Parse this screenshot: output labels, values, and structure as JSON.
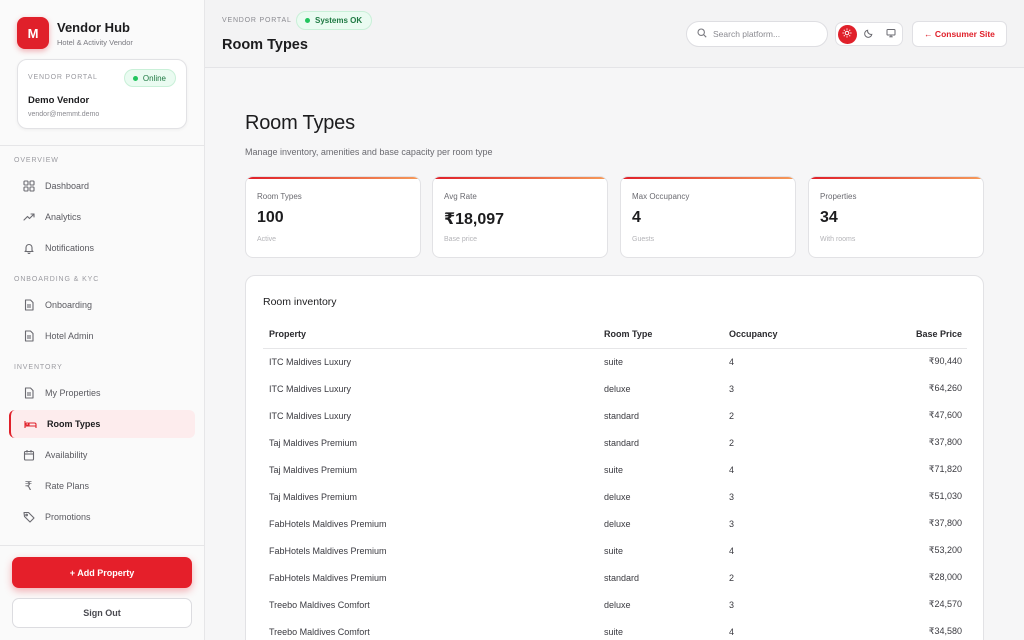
{
  "brand": {
    "logo_letter": "M",
    "name": "Vendor Hub",
    "subtitle": "Hotel & Activity Vendor"
  },
  "vendor_card": {
    "label": "VENDOR PORTAL",
    "status": "Online",
    "name": "Demo Vendor",
    "email": "vendor@memmt.demo"
  },
  "sidebar": {
    "sections": [
      {
        "label": "OVERVIEW",
        "items": [
          {
            "label": "Dashboard",
            "icon": "grid-icon"
          },
          {
            "label": "Analytics",
            "icon": "trend-icon"
          },
          {
            "label": "Notifications",
            "icon": "bell-icon"
          }
        ]
      },
      {
        "label": "ONBOARDING & KYC",
        "items": [
          {
            "label": "Onboarding",
            "icon": "document-icon"
          },
          {
            "label": "Hotel Admin",
            "icon": "document-icon"
          }
        ]
      },
      {
        "label": "INVENTORY",
        "items": [
          {
            "label": "My Properties",
            "icon": "document-icon"
          },
          {
            "label": "Room Types",
            "icon": "bed-icon",
            "active": true
          },
          {
            "label": "Availability",
            "icon": "calendar-icon"
          },
          {
            "label": "Rate Plans",
            "icon": "rupee-icon"
          },
          {
            "label": "Promotions",
            "icon": "tag-icon"
          }
        ]
      }
    ],
    "add_property": "+ Add Property",
    "sign_out": "Sign Out"
  },
  "topbar": {
    "portal_label": "VENDOR PORTAL",
    "system_status": "Systems OK",
    "title": "Room Types",
    "search_placeholder": "Search platform...",
    "consumer_site": "← Consumer Site"
  },
  "main": {
    "title": "Room Types",
    "subtitle": "Manage inventory, amenities and base capacity per room type",
    "stats": [
      {
        "label": "Room Types",
        "value": "100",
        "note": "Active"
      },
      {
        "label": "Avg Rate",
        "value": "₹18,097",
        "note": "Base price"
      },
      {
        "label": "Max Occupancy",
        "value": "4",
        "note": "Guests"
      },
      {
        "label": "Properties",
        "value": "34",
        "note": "With rooms"
      }
    ],
    "table": {
      "title": "Room inventory",
      "columns": [
        "Property",
        "Room Type",
        "Occupancy",
        "Base Price"
      ],
      "rows": [
        [
          "ITC Maldives Luxury",
          "suite",
          "4",
          "₹90,440"
        ],
        [
          "ITC Maldives Luxury",
          "deluxe",
          "3",
          "₹64,260"
        ],
        [
          "ITC Maldives Luxury",
          "standard",
          "2",
          "₹47,600"
        ],
        [
          "Taj Maldives Premium",
          "standard",
          "2",
          "₹37,800"
        ],
        [
          "Taj Maldives Premium",
          "suite",
          "4",
          "₹71,820"
        ],
        [
          "Taj Maldives Premium",
          "deluxe",
          "3",
          "₹51,030"
        ],
        [
          "FabHotels Maldives Premium",
          "deluxe",
          "3",
          "₹37,800"
        ],
        [
          "FabHotels Maldives Premium",
          "suite",
          "4",
          "₹53,200"
        ],
        [
          "FabHotels Maldives Premium",
          "standard",
          "2",
          "₹28,000"
        ],
        [
          "Treebo Maldives Comfort",
          "deluxe",
          "3",
          "₹24,570"
        ],
        [
          "Treebo Maldives Comfort",
          "suite",
          "4",
          "₹34,580"
        ]
      ]
    }
  },
  "colors": {
    "accent": "#e0202a",
    "success": "#22c55e"
  }
}
